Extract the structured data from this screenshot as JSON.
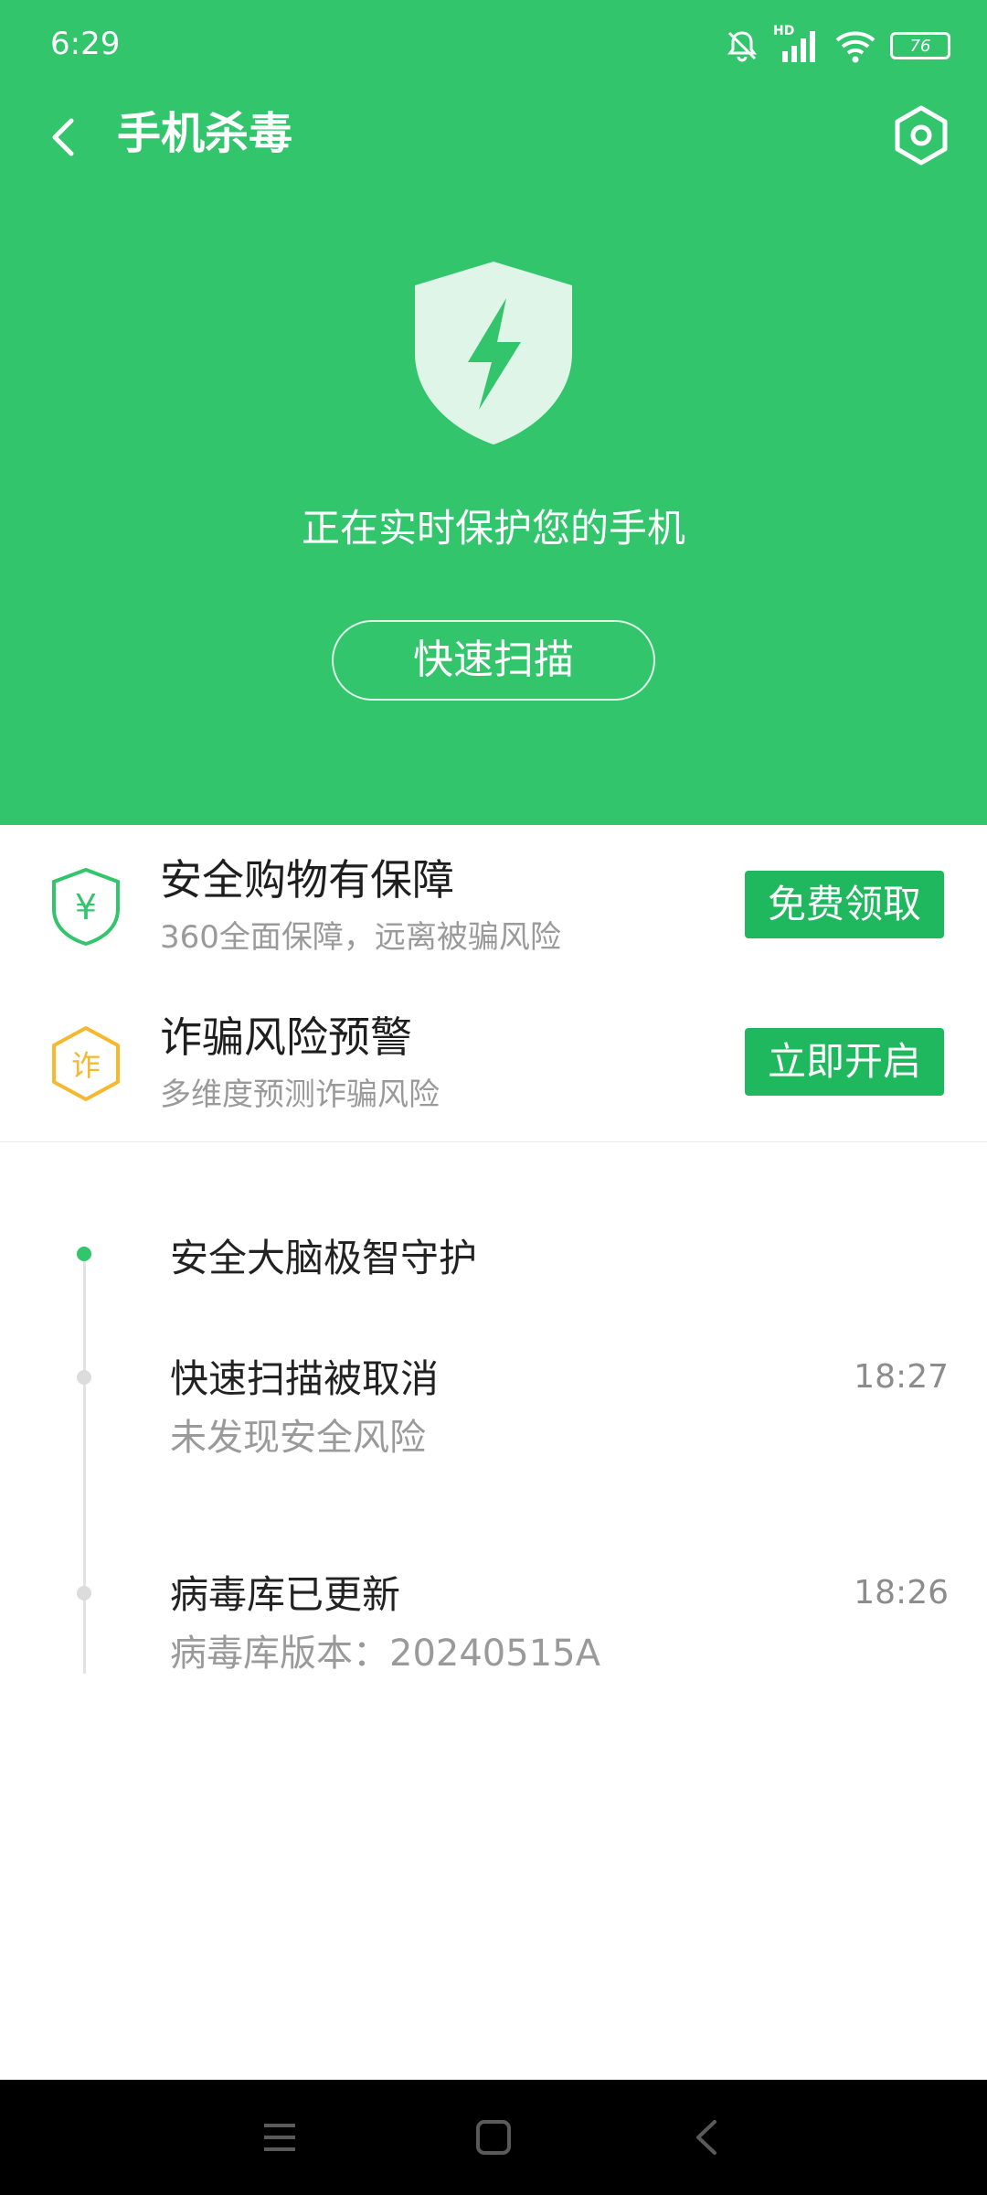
{
  "status_bar": {
    "time": "6:29",
    "battery": "76",
    "network_label": "HD"
  },
  "app_bar": {
    "title": "手机杀毒"
  },
  "hero": {
    "status_text": "正在实时保护您的手机",
    "scan_button": "快速扫描"
  },
  "promos": [
    {
      "title": "安全购物有保障",
      "subtitle": "360全面保障，远离被骗风险",
      "button": "免费领取",
      "icon": "yen-shield-icon",
      "icon_glyph": "¥"
    },
    {
      "title": "诈骗风险预警",
      "subtitle": "多维度预测诈骗风险",
      "button": "立即开启",
      "icon": "fraud-hexagon-icon",
      "icon_glyph": "诈"
    }
  ],
  "timeline": [
    {
      "title": "安全大脑极智守护",
      "subtitle": "",
      "time": ""
    },
    {
      "title": "快速扫描被取消",
      "subtitle": "未发现安全风险",
      "time": "18:27"
    },
    {
      "title": "病毒库已更新",
      "subtitle": "病毒库版本：20240515A",
      "time": "18:26"
    }
  ],
  "colors": {
    "primary_green": "#32c56c",
    "button_green": "#1fb85e",
    "warning_yellow": "#f5b82e"
  }
}
